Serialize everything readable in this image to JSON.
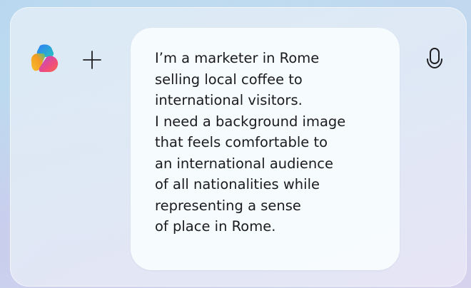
{
  "composer": {
    "logo_icon": "copilot-logo-icon",
    "add_icon": "plus-icon",
    "mic_icon": "microphone-icon",
    "message_lines": [
      "I’m a marketer in Rome",
      "selling local coffee to",
      "international visitors.",
      "I need a background image",
      "that feels comfortable to",
      "an international audience",
      "of all nationalities while",
      "representing a sense",
      "of place in Rome."
    ]
  },
  "colors": {
    "background_start": "#b9d8ef",
    "background_end": "#d6d2ee",
    "bubble": "#f7fbfe",
    "text": "#1b1b1f",
    "icon": "#1f1f23"
  }
}
